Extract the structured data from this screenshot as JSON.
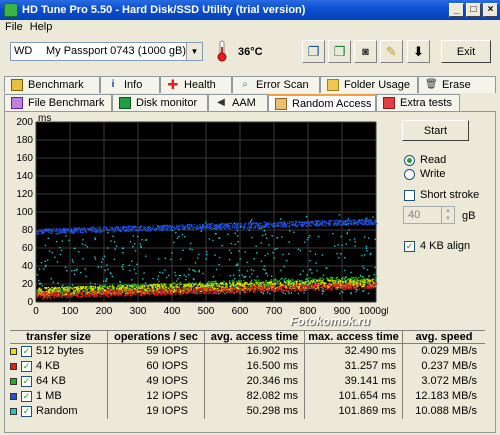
{
  "window": {
    "title": "HD Tune Pro 5.50 - Hard Disk/SSD Utility (trial version)",
    "minimize": "_",
    "maximize": "□",
    "close": "×"
  },
  "menu": {
    "file": "File",
    "help": "Help"
  },
  "toolbar": {
    "drive_prefix": "WD",
    "drive_name": "My Passport 0743 (1000 gB)",
    "temperature": "36°C",
    "exit_label": "Exit"
  },
  "tabs_top": [
    {
      "label": "Benchmark",
      "icon": "benchmark-icon"
    },
    {
      "label": "Info",
      "icon": "info-icon"
    },
    {
      "label": "Health",
      "icon": "health-icon"
    },
    {
      "label": "Error Scan",
      "icon": "error-scan-icon"
    },
    {
      "label": "Folder Usage",
      "icon": "folder-icon"
    },
    {
      "label": "Erase",
      "icon": "erase-icon"
    }
  ],
  "tabs_bottom": [
    {
      "label": "File Benchmark",
      "icon": "file-benchmark-icon"
    },
    {
      "label": "Disk monitor",
      "icon": "disk-monitor-icon"
    },
    {
      "label": "AAM",
      "icon": "speaker-icon"
    },
    {
      "label": "Random Access",
      "icon": "random-access-icon",
      "active": true
    },
    {
      "label": "Extra tests",
      "icon": "extra-tests-icon"
    }
  ],
  "controls": {
    "start_label": "Start",
    "read_label": "Read",
    "write_label": "Write",
    "mode": "read",
    "short_stroke_label": "Short stroke",
    "short_stroke_checked": false,
    "short_stroke_value": "40",
    "short_stroke_unit": "gB",
    "align_label": "4 KB align",
    "align_checked": true
  },
  "watermark": "Fotokomok.ru",
  "table": {
    "headers": [
      "transfer size",
      "operations / sec",
      "avg. access time",
      "max. access time",
      "avg. speed"
    ],
    "rows": [
      {
        "label": "512 bytes",
        "color": "#E8E000",
        "ops": "59 IOPS",
        "avg": "16.902 ms",
        "max": "32.490 ms",
        "speed": "0.029 MB/s"
      },
      {
        "label": "4 KB",
        "color": "#E02020",
        "ops": "60 IOPS",
        "avg": "16.500 ms",
        "max": "31.257 ms",
        "speed": "0.237 MB/s"
      },
      {
        "label": "64 KB",
        "color": "#20B020",
        "ops": "49 IOPS",
        "avg": "20.346 ms",
        "max": "39.141 ms",
        "speed": "3.072 MB/s"
      },
      {
        "label": "1 MB",
        "color": "#2050E0",
        "ops": "12 IOPS",
        "avg": "82.082 ms",
        "max": "101.654 ms",
        "speed": "12.183 MB/s"
      },
      {
        "label": "Random",
        "color": "#20C8C8",
        "ops": "19 IOPS",
        "avg": "50.298 ms",
        "max": "101.869 ms",
        "speed": "10.088 MB/s"
      }
    ]
  },
  "chart_data": {
    "type": "scatter",
    "ylabel": "ms",
    "xlabel": "",
    "x_ticks": [
      "0",
      "100",
      "200",
      "300",
      "400",
      "500",
      "600",
      "700",
      "800",
      "900",
      "1000gB"
    ],
    "y_ticks": [
      "0",
      "20",
      "40",
      "60",
      "80",
      "100",
      "120",
      "140",
      "160",
      "180",
      "200"
    ],
    "xlim": [
      0,
      1000
    ],
    "ylim": [
      0,
      200
    ],
    "grid": true,
    "background": "#000000",
    "series": [
      {
        "name": "512 bytes",
        "color": "#E8E000",
        "y_start": 12,
        "y_end": 22,
        "spread": 9
      },
      {
        "name": "4 KB",
        "color": "#E02020",
        "y_start": 8,
        "y_end": 19,
        "spread": 7
      },
      {
        "name": "64 KB",
        "color": "#20B020",
        "y_start": 12,
        "y_end": 25,
        "spread": 10
      },
      {
        "name": "1 MB",
        "color": "#2050E0",
        "y_start": 79,
        "y_end": 90,
        "spread": 6
      },
      {
        "name": "Random",
        "color": "#20C8C8",
        "y_start": 40,
        "y_end": 60,
        "spread": 40
      }
    ]
  }
}
